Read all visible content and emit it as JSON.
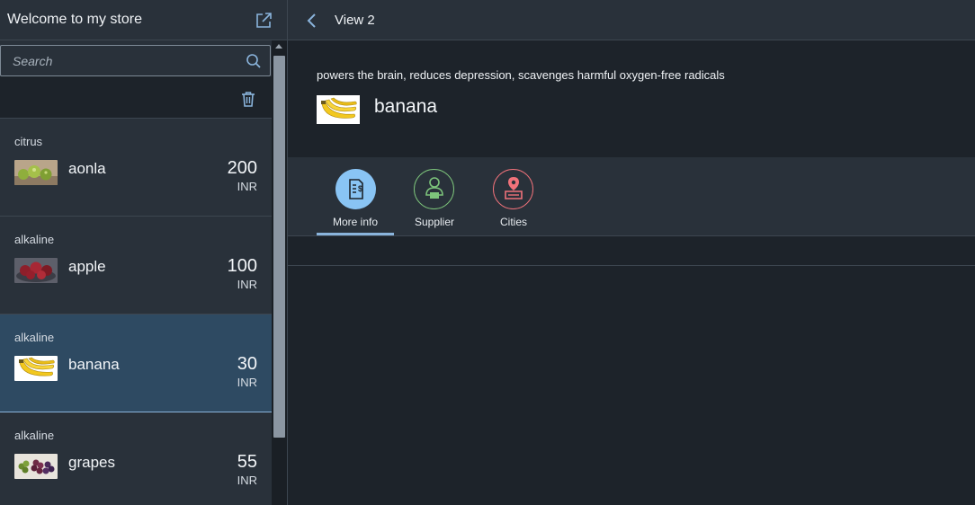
{
  "master": {
    "title": "Welcome to my store",
    "search": {
      "placeholder": "Search",
      "value": ""
    },
    "items": [
      {
        "category": "citrus",
        "name": "aonla",
        "price": "200",
        "currency": "INR",
        "selected": false
      },
      {
        "category": "alkaline",
        "name": "apple",
        "price": "100",
        "currency": "INR",
        "selected": false
      },
      {
        "category": "alkaline",
        "name": "banana",
        "price": "30",
        "currency": "INR",
        "selected": true
      },
      {
        "category": "alkaline",
        "name": "grapes",
        "price": "55",
        "currency": "INR",
        "selected": false
      }
    ]
  },
  "detail": {
    "header_title": "View 2",
    "description": "powers the brain, reduces depression, scavenges harmful oxygen-free radicals",
    "object_title": "banana",
    "tabs": [
      {
        "label": "More info",
        "icon": "invoice-icon",
        "color": "#89c4f4",
        "selected": true
      },
      {
        "label": "Supplier",
        "icon": "supplier-icon",
        "color": "#7dc47b",
        "selected": false
      },
      {
        "label": "Cities",
        "icon": "location-icon",
        "color": "#f0727a",
        "selected": false
      }
    ]
  },
  "colors": {
    "accent": "#8ab4dc",
    "selected_row": "#2e4a62",
    "shell": "#29313a",
    "background": "#1d232a"
  }
}
